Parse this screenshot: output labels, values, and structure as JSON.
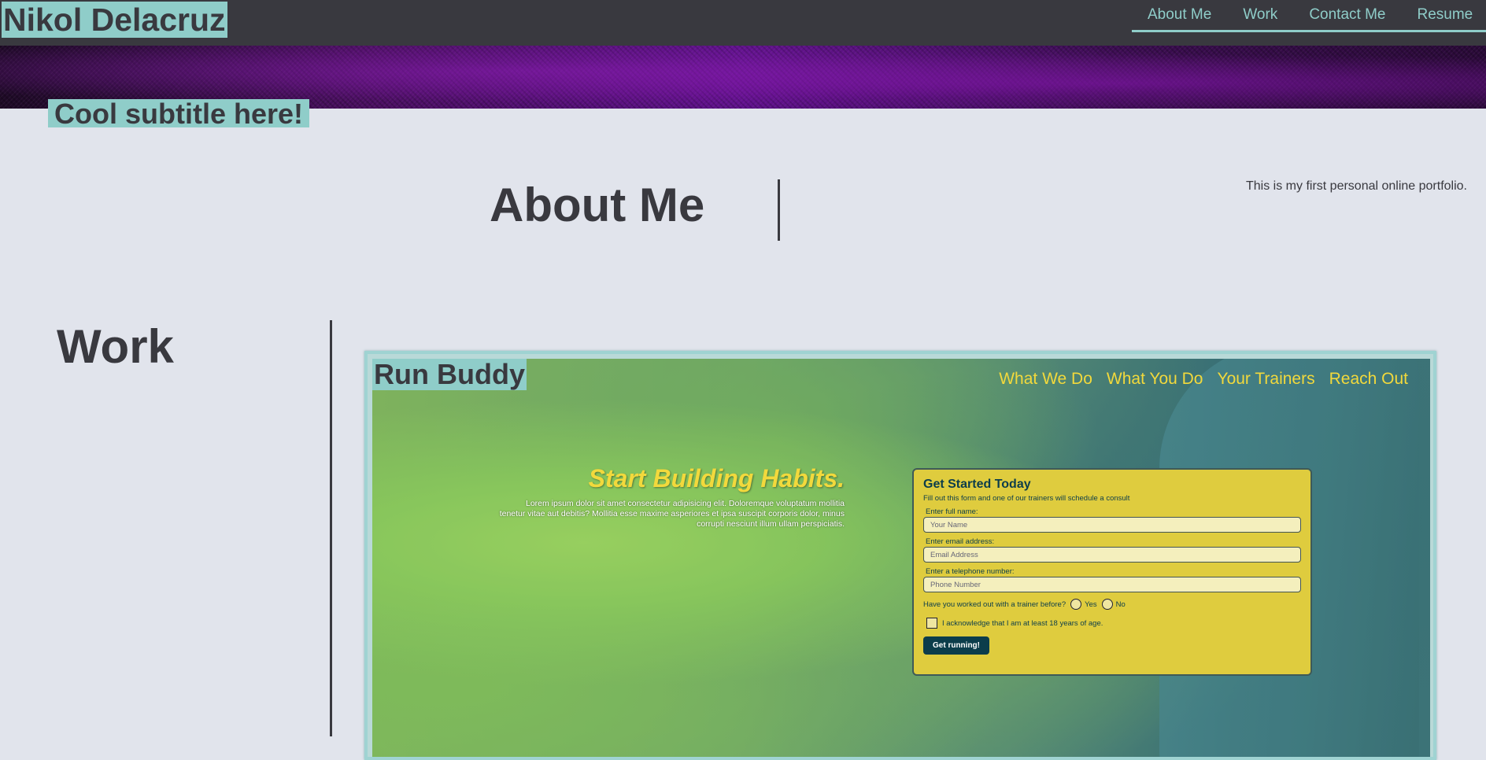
{
  "header": {
    "site_name": "Nikol Delacruz",
    "nav": [
      "About Me",
      "Work",
      "Contact Me",
      "Resume"
    ]
  },
  "hero": {
    "subtitle": "Cool subtitle here!"
  },
  "about": {
    "heading": "About Me",
    "text": "This is my first personal online portfolio."
  },
  "work": {
    "heading": "Work",
    "project": {
      "logo": "Run Buddy",
      "nav": [
        "What We Do",
        "What You Do",
        "Your Trainers",
        "Reach Out"
      ],
      "headline": "Start Building Habits.",
      "lead": "Lorem ipsum dolor sit amet consectetur adipisicing elit. Doloremque voluptatum mollitia tenetur vitae aut debitis? Mollitia esse maxime asperiores et ipsa suscipit corporis dolor, minus corrupti nesciunt illum ullam perspiciatis.",
      "form": {
        "title": "Get Started Today",
        "intro": "Fill out this form and one of our trainers will schedule a consult",
        "name_label": "Enter full name:",
        "name_placeholder": "Your Name",
        "email_label": "Enter email address:",
        "email_placeholder": "Email Address",
        "phone_label": "Enter a telephone number:",
        "phone_placeholder": "Phone Number",
        "trainer_question": "Have you worked out with a trainer before?",
        "yes": "Yes",
        "no": "No",
        "acknowledge": "I acknowledge that I am at least 18 years of age.",
        "submit": "Get running!"
      }
    }
  },
  "colors": {
    "accent": "#8fcdc9",
    "dark": "#39393f",
    "background": "#e1e4ec",
    "runbuddy_yellow": "#f2d93c",
    "runbuddy_navy": "#0c3d4b"
  }
}
